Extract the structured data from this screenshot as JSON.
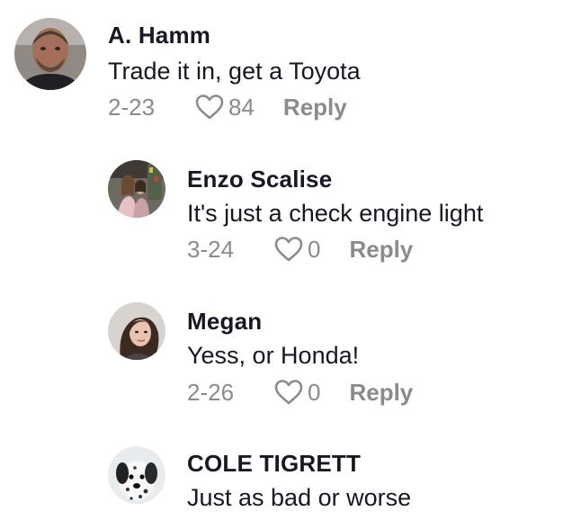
{
  "comments": [
    {
      "username": "A. Hamm",
      "text": "Trade it in, get a Toyota",
      "date": "2-23",
      "likes": "84",
      "reply_label": "Reply",
      "avatar": "avatar-man-photo"
    },
    {
      "username": "Enzo Scalise",
      "text": "It's just a check engine light",
      "date": "3-24",
      "likes": "0",
      "reply_label": "Reply",
      "avatar": "avatar-two-people-photo"
    },
    {
      "username": "Megan",
      "text": "Yess, or Honda!",
      "date": "2-26",
      "likes": "0",
      "reply_label": "Reply",
      "avatar": "avatar-woman-photo"
    },
    {
      "username": "COLE TIGRETT",
      "text": "Just as bad or worse",
      "avatar": "avatar-dalmatian-photo"
    }
  ],
  "colors": {
    "text_primary": "#161823",
    "text_secondary": "#8a8b91",
    "background": "#ffffff"
  },
  "icons": {
    "like": "heart-outline-icon"
  }
}
